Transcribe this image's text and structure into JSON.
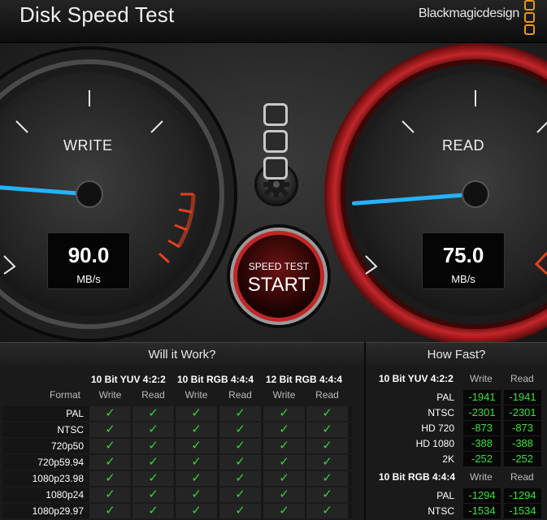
{
  "title": "Disk Speed Test",
  "brand": "Blackmagicdesign",
  "gauges": {
    "write": {
      "label": "WRITE",
      "value": "90.0",
      "unit": "MB/s",
      "level": 90.0
    },
    "read": {
      "label": "READ",
      "value": "75.0",
      "unit": "MB/s",
      "level": 75.0
    }
  },
  "start_button": {
    "top": "SPEED TEST",
    "main": "START"
  },
  "will_it_work": {
    "title": "Will it Work?",
    "groups": [
      "10 Bit YUV 4:2:2",
      "10 Bit RGB 4:4:4",
      "12 Bit RGB 4:4:4"
    ],
    "format_label": "Format",
    "write_label": "Write",
    "read_label": "Read",
    "formats": [
      "PAL",
      "NTSC",
      "720p50",
      "720p59.94",
      "1080p23.98",
      "1080p24",
      "1080p29.97"
    ],
    "check": "✓"
  },
  "how_fast": {
    "title": "How Fast?",
    "sections": [
      {
        "name": "10 Bit YUV 4:2:2",
        "write_label": "Write",
        "read_label": "Read",
        "rows": [
          {
            "label": "PAL",
            "write": "-1941",
            "read": "-1941"
          },
          {
            "label": "NTSC",
            "write": "-2301",
            "read": "-2301"
          },
          {
            "label": "HD 720",
            "write": "-873",
            "read": "-873"
          },
          {
            "label": "HD 1080",
            "write": "-388",
            "read": "-388"
          },
          {
            "label": "2K",
            "write": "-252",
            "read": "-252"
          }
        ]
      },
      {
        "name": "10 Bit RGB 4:4:4",
        "write_label": "Write",
        "read_label": "Read",
        "rows": [
          {
            "label": "PAL",
            "write": "-1294",
            "read": "-1294"
          },
          {
            "label": "NTSC",
            "write": "-1534",
            "read": "-1534"
          }
        ]
      }
    ]
  }
}
